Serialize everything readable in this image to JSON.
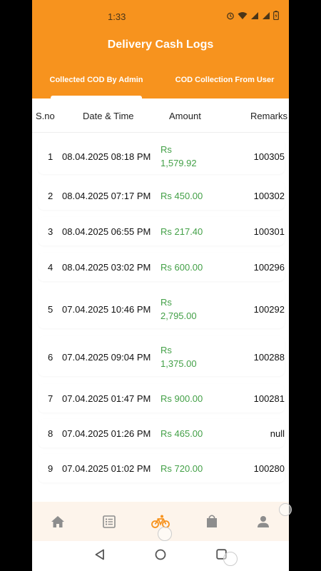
{
  "status_bar": {
    "time": "1:33"
  },
  "header": {
    "title": "Delivery Cash Logs",
    "tabs": [
      {
        "label": "Collected COD By Admin",
        "active": true
      },
      {
        "label": "COD Collection From User",
        "active": false
      }
    ]
  },
  "table": {
    "columns": [
      "S.no",
      "Date & Time",
      "Amount",
      "Remarks"
    ],
    "rows": [
      {
        "sno": "1",
        "datetime": "08.04.2025 08:18 PM",
        "amount": "Rs 1,579.92",
        "remarks": "100305"
      },
      {
        "sno": "2",
        "datetime": "08.04.2025 07:17 PM",
        "amount": "Rs 450.00",
        "remarks": "100302"
      },
      {
        "sno": "3",
        "datetime": "08.04.2025 06:55 PM",
        "amount": "Rs 217.40",
        "remarks": "100301"
      },
      {
        "sno": "4",
        "datetime": "08.04.2025 03:02 PM",
        "amount": "Rs 600.00",
        "remarks": "100296"
      },
      {
        "sno": "5",
        "datetime": "07.04.2025 10:46 PM",
        "amount": "Rs 2,795.00",
        "remarks": "100292"
      },
      {
        "sno": "6",
        "datetime": "07.04.2025 09:04 PM",
        "amount": "Rs 1,375.00",
        "remarks": "100288"
      },
      {
        "sno": "7",
        "datetime": "07.04.2025 01:47 PM",
        "amount": "Rs 900.00",
        "remarks": "100281"
      },
      {
        "sno": "8",
        "datetime": "07.04.2025 01:26 PM",
        "amount": "Rs 465.00",
        "remarks": "null"
      },
      {
        "sno": "9",
        "datetime": "07.04.2025 01:02 PM",
        "amount": "Rs 720.00",
        "remarks": "100280"
      }
    ]
  },
  "bottom_nav": {
    "items": [
      {
        "icon": "home-icon",
        "active": false
      },
      {
        "icon": "list-icon",
        "active": false
      },
      {
        "icon": "bicycle-icon",
        "active": true
      },
      {
        "icon": "shopping-bag-icon",
        "active": false
      },
      {
        "icon": "person-icon",
        "active": false
      }
    ]
  },
  "colors": {
    "accent": "#F7931E",
    "amount": "#43A047",
    "nav_bg": "#FDF4EB"
  }
}
